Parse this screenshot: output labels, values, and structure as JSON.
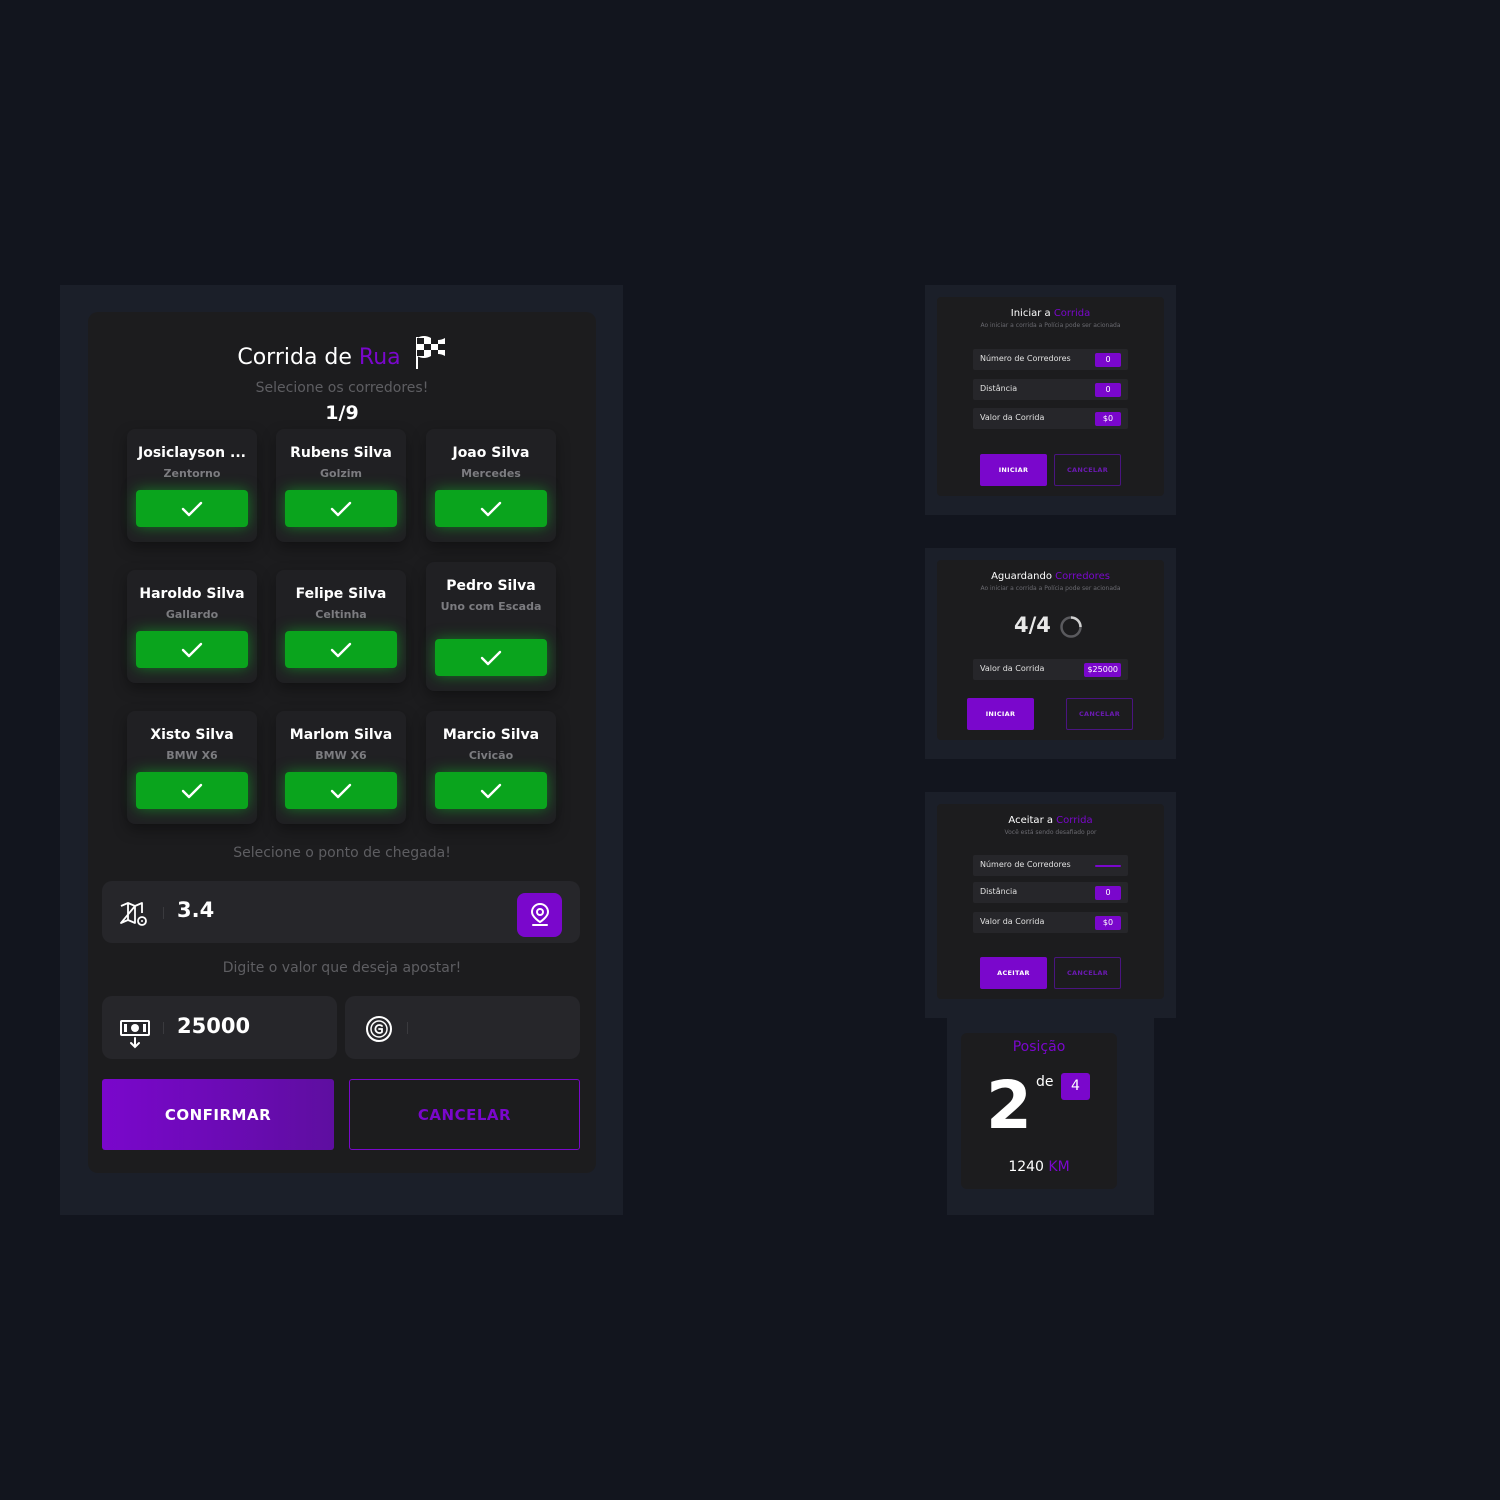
{
  "main": {
    "title_prefix": "Corrida de ",
    "title_accent": "Rua",
    "select_runners_label": "Selecione os corredores!",
    "selected_count": "1/9",
    "runners": [
      {
        "name": "Josiclayson ...",
        "car": "Zentorno"
      },
      {
        "name": "Rubens Silva",
        "car": "Golzim"
      },
      {
        "name": "Joao Silva",
        "car": "Mercedes"
      },
      {
        "name": "Haroldo Silva",
        "car": "Gallardo"
      },
      {
        "name": "Felipe Silva",
        "car": "Celtinha"
      },
      {
        "name": "Pedro Silva",
        "car": "Uno com Escada"
      },
      {
        "name": "Xisto Silva",
        "car": "BMW X6"
      },
      {
        "name": "Marlom Silva",
        "car": "BMW X6"
      },
      {
        "name": "Marcio Silva",
        "car": "Civicão"
      }
    ],
    "arrival_label": "Selecione o ponto de chegada!",
    "distance_value": "3.4",
    "bet_label": "Digite o valor que deseja apostar!",
    "bet_value": "25000",
    "coin_value": "",
    "confirm_label": "CONFIRMAR",
    "cancel_label": "CANCELAR"
  },
  "start_panel": {
    "title_prefix": "Iniciar a ",
    "title_accent": "Corrida",
    "subtitle": "Ao iniciar a corrida a Polícia pode ser acionada",
    "rows": [
      {
        "label": "Número de Corredores",
        "value": "0"
      },
      {
        "label": "Distância",
        "value": "0"
      },
      {
        "label": "Valor da Corrida",
        "value": "$0"
      }
    ],
    "start_label": "INICIAR",
    "cancel_label": "CANCELAR"
  },
  "waiting_panel": {
    "title_prefix": "Aguardando ",
    "title_accent": "Corredores",
    "subtitle": "Ao iniciar a corrida a Polícia pode ser acionada",
    "count": "4/4",
    "rows": [
      {
        "label": "Valor da Corrida",
        "value": "$25000"
      }
    ],
    "start_label": "INICIAR",
    "cancel_label": "CANCELAR"
  },
  "accept_panel": {
    "title_prefix": "Aceitar a ",
    "title_accent": "Corrida",
    "subtitle": "Você está sendo desafiado por",
    "rows": [
      {
        "label": "Número de Corredores",
        "value": ""
      },
      {
        "label": "Distância",
        "value": "0"
      },
      {
        "label": "Valor da Corrida",
        "value": "$0"
      }
    ],
    "accept_label": "ACEITAR",
    "cancel_label": "CANCELAR"
  },
  "position_panel": {
    "title": "Posição",
    "position": "2",
    "of_label": "de",
    "total": "4",
    "distance_value": "1240",
    "distance_unit": "KM"
  },
  "colors": {
    "accent": "#7a07cc",
    "success": "#0aa41d",
    "background": "#12151e",
    "card": "#1c1c1e"
  },
  "icons": {
    "flag": "checkered-flag-icon",
    "check": "check-icon",
    "map": "map-icon",
    "pin": "location-pin-icon",
    "money": "money-icon",
    "coin": "coin-icon",
    "spinner": "loading-spinner-icon"
  }
}
